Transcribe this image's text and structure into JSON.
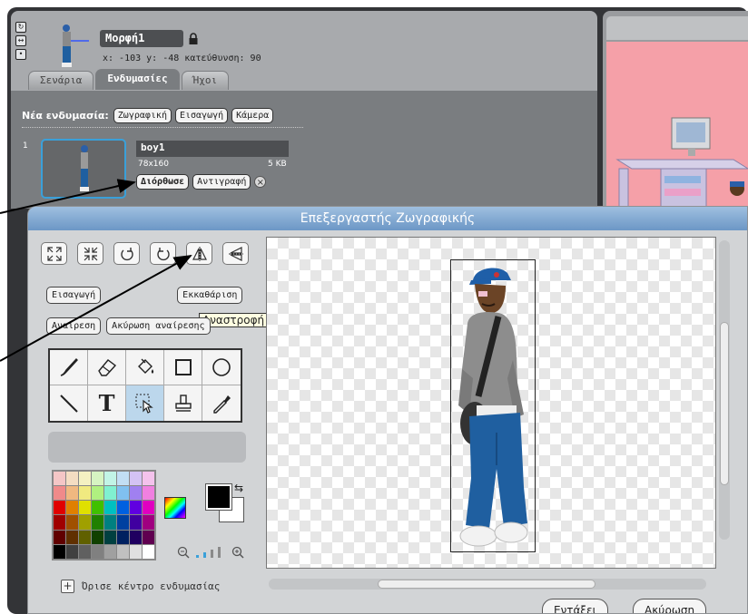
{
  "sprite": {
    "name": "Μορφή1",
    "coords": "x: -103  y: -48   κατεύθυνση: 90"
  },
  "tabs": [
    {
      "label": "Σενάρια"
    },
    {
      "label": "Ενδυμασίες"
    },
    {
      "label": "Ήχοι"
    }
  ],
  "new_costume": {
    "label": "Νέα ενδυμασία:",
    "paint": "Ζωγραφική",
    "import": "Εισαγωγή",
    "camera": "Κάμερα"
  },
  "costume": {
    "index": "1",
    "name": "boy1",
    "size": "78x160",
    "filesize": "5 KB",
    "edit": "Διόρθωσε",
    "copy": "Αντιγραφή",
    "delete": "×"
  },
  "editor": {
    "title": "Επεξεργαστής Ζωγραφικής",
    "tooltip": "Αναστροφή οριζόντια",
    "import": "Εισαγωγή",
    "clear": "Εκκαθάριση",
    "undo": "Αναίρεση",
    "redo": "Ακύρωση αναίρεσης",
    "center": "Όρισε κέντρο ενδυμασίας",
    "ok": "Εντάξει",
    "cancel": "Ακύρωση",
    "tools": [
      "paintbrush-tool",
      "eraser-tool",
      "fill-tool",
      "rectangle-tool",
      "ellipse-tool",
      "line-tool",
      "text-tool",
      "select-tool",
      "stamp-tool",
      "eyedropper-tool"
    ],
    "text_tool_glyph": "T"
  },
  "colors": {
    "accent": "#3aa0d9",
    "title_bar": "#6c97c6",
    "foreground": "#000000",
    "background": "#ffffff",
    "palette": [
      "#f4c6c6",
      "#f4ddc2",
      "#f4f1c2",
      "#d6f4c2",
      "#c2f4e6",
      "#c2def4",
      "#d4c2f4",
      "#f4c2ec",
      "#f08a8a",
      "#f0b880",
      "#f0ea80",
      "#b0f080",
      "#80f0d0",
      "#80c0f0",
      "#a080f0",
      "#f080e0",
      "#e00000",
      "#e08000",
      "#e0e000",
      "#40c000",
      "#00c0c0",
      "#0060e0",
      "#6000e0",
      "#e000c0",
      "#a00000",
      "#a05000",
      "#a0a000",
      "#208000",
      "#008080",
      "#0040a0",
      "#4000a0",
      "#a00080",
      "#600000",
      "#603000",
      "#606000",
      "#104000",
      "#004040",
      "#002060",
      "#200060",
      "#600050",
      "#000000",
      "#404040",
      "#606060",
      "#808080",
      "#a0a0a0",
      "#c0c0c0",
      "#e0e0e0",
      "#ffffff"
    ]
  }
}
